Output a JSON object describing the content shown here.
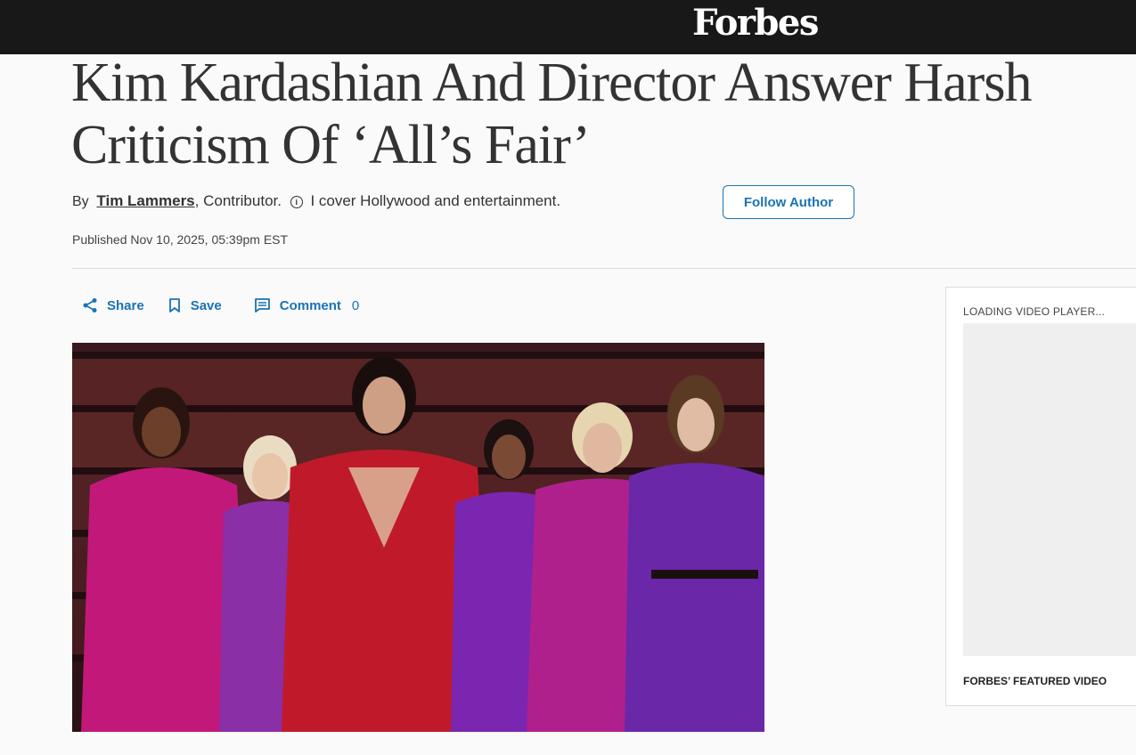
{
  "header": {
    "logo": "Forbes"
  },
  "article": {
    "headline": "Kim Kardashian And Director Answer Harsh Criticism Of ‘All’s Fair’",
    "byline": {
      "by": "By",
      "author": "Tim Lammers",
      "role": ", Contributor.",
      "description": "I cover Hollywood and entertainment."
    },
    "follow_label": "Follow Author",
    "published": "Published Nov 10, 2025, 05:39pm EST",
    "actions": {
      "share_label": "Share",
      "save_label": "Save",
      "comment_label": "Comment",
      "comment_count": "0"
    }
  },
  "sidebar": {
    "loading_label": "LOADING VIDEO PLAYER...",
    "featured_label": "FORBES’ FEATURED VIDEO"
  },
  "colors": {
    "topbar": "#181818",
    "accent": "#1a73b5",
    "background": "#fafafa"
  },
  "icons": [
    "share-icon",
    "bookmark-icon",
    "comment-icon",
    "info-icon"
  ]
}
